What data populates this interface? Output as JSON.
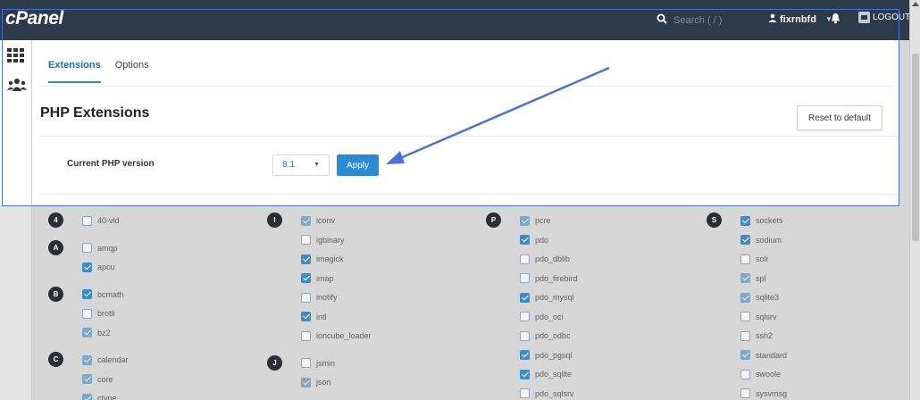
{
  "app": {
    "logo": "cPanel"
  },
  "header": {
    "search_placeholder": "Search ( / )",
    "username": "fixrnbfd",
    "logout": "LOGOUT"
  },
  "tabs": [
    {
      "label": "Extensions",
      "active": true
    },
    {
      "label": "Options",
      "active": false
    }
  ],
  "page": {
    "title": "PHP Extensions",
    "reset_button": "Reset to default",
    "current_version_label": "Current PHP version",
    "current_version_value": "8.1",
    "apply_button": "Apply"
  },
  "colors": {
    "topbar": "#2d3a4a",
    "accent": "#2b8ad2",
    "highlight": "#4a72d8"
  },
  "extension_columns": [
    {
      "groups": [
        {
          "letter": "4",
          "items": [
            {
              "name": "40-vld",
              "checked": false,
              "state": "off"
            }
          ]
        },
        {
          "letter": "A",
          "items": [
            {
              "name": "amqp",
              "checked": false,
              "state": "off"
            },
            {
              "name": "apcu",
              "checked": true,
              "state": "on"
            }
          ]
        },
        {
          "letter": "B",
          "items": [
            {
              "name": "bcmath",
              "checked": true,
              "state": "on"
            },
            {
              "name": "brotli",
              "checked": false,
              "state": "off"
            },
            {
              "name": "bz2",
              "checked": true,
              "state": "faded"
            }
          ]
        },
        {
          "letter": "C",
          "items": [
            {
              "name": "calendar",
              "checked": true,
              "state": "faded"
            },
            {
              "name": "core",
              "checked": true,
              "state": "faded"
            },
            {
              "name": "ctype",
              "checked": true,
              "state": "faded"
            }
          ]
        }
      ]
    },
    {
      "groups": [
        {
          "letter": "I",
          "items": [
            {
              "name": "iconv",
              "checked": true,
              "state": "faded"
            },
            {
              "name": "igbinary",
              "checked": false,
              "state": "off"
            },
            {
              "name": "imagick",
              "checked": true,
              "state": "on"
            },
            {
              "name": "imap",
              "checked": true,
              "state": "on"
            },
            {
              "name": "inotify",
              "checked": false,
              "state": "off"
            },
            {
              "name": "intl",
              "checked": true,
              "state": "on"
            },
            {
              "name": "ioncube_loader",
              "checked": false,
              "state": "off"
            }
          ]
        },
        {
          "letter": "J",
          "items": [
            {
              "name": "jsmin",
              "checked": false,
              "state": "off"
            },
            {
              "name": "json",
              "checked": true,
              "state": "faded"
            }
          ]
        }
      ]
    },
    {
      "groups": [
        {
          "letter": "P",
          "items": [
            {
              "name": "pcre",
              "checked": true,
              "state": "faded"
            },
            {
              "name": "pdo",
              "checked": true,
              "state": "on"
            },
            {
              "name": "pdo_dblib",
              "checked": false,
              "state": "off"
            },
            {
              "name": "pdo_firebird",
              "checked": false,
              "state": "off"
            },
            {
              "name": "pdo_mysql",
              "checked": true,
              "state": "on"
            },
            {
              "name": "pdo_oci",
              "checked": false,
              "state": "off"
            },
            {
              "name": "pdo_odbc",
              "checked": false,
              "state": "off"
            },
            {
              "name": "pdo_pgsql",
              "checked": true,
              "state": "on"
            },
            {
              "name": "pdo_sqlite",
              "checked": true,
              "state": "on"
            },
            {
              "name": "pdo_sqlsrv",
              "checked": false,
              "state": "off"
            }
          ]
        }
      ]
    },
    {
      "groups": [
        {
          "letter": "S",
          "items": [
            {
              "name": "sockets",
              "checked": true,
              "state": "on"
            },
            {
              "name": "sodium",
              "checked": true,
              "state": "on"
            },
            {
              "name": "solr",
              "checked": false,
              "state": "off"
            },
            {
              "name": "spl",
              "checked": true,
              "state": "faded"
            },
            {
              "name": "sqlite3",
              "checked": true,
              "state": "faded"
            },
            {
              "name": "sqlsrv",
              "checked": false,
              "state": "off"
            },
            {
              "name": "ssh2",
              "checked": false,
              "state": "off"
            },
            {
              "name": "standard",
              "checked": true,
              "state": "faded"
            },
            {
              "name": "swoole",
              "checked": false,
              "state": "off"
            },
            {
              "name": "sysvmsg",
              "checked": false,
              "state": "off"
            }
          ]
        }
      ]
    }
  ]
}
